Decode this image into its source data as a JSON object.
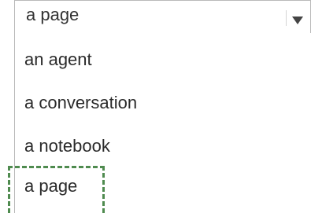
{
  "dropdown": {
    "selected_value": "a page",
    "options": [
      "an agent",
      "a conversation",
      "a notebook",
      "a page"
    ]
  },
  "colors": {
    "border": "#b9b9b9",
    "focus_outline": "#4f8b4f",
    "text": "#2a2a2a"
  },
  "icons": {
    "caret": "chevron-down-icon"
  }
}
